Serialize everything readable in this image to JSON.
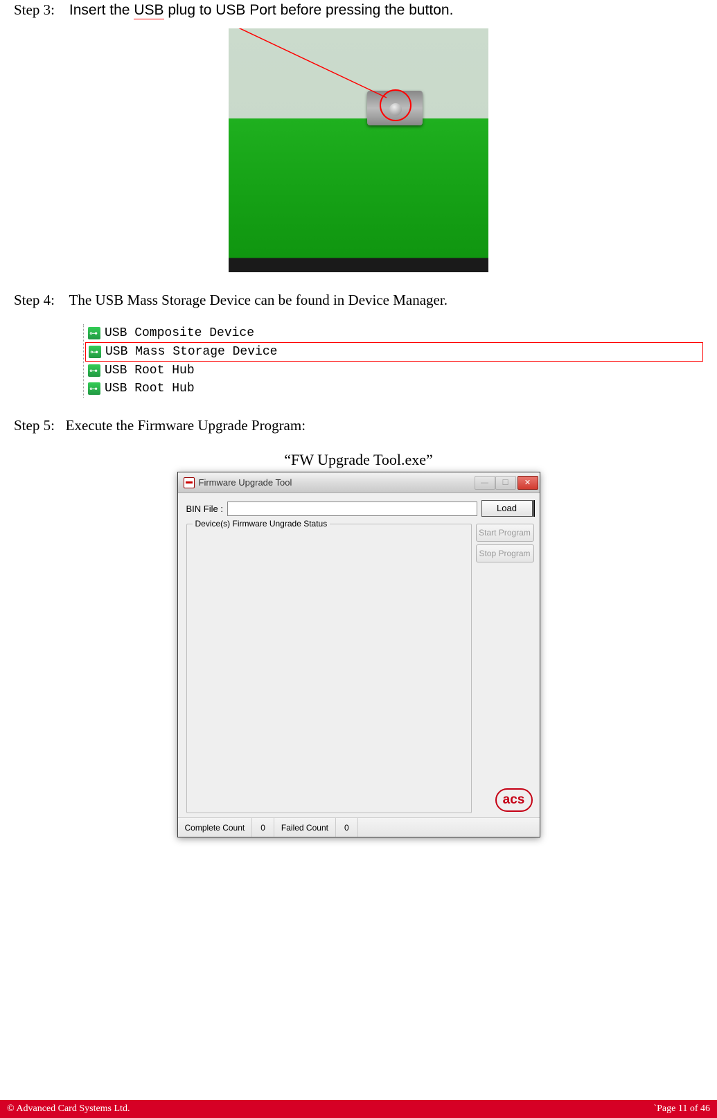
{
  "step3": {
    "label": "Step 3:",
    "sentence_prefix": "Insert the ",
    "usb_word": "USB",
    "sentence_suffix": " plug to USB Port before pressing the button."
  },
  "step4": {
    "label": "Step 4:",
    "text": "The USB Mass Storage Device can be found in Device Manager."
  },
  "device_manager": {
    "items": [
      {
        "name": "USB Composite Device",
        "highlighted": false
      },
      {
        "name": "USB Mass Storage Device",
        "highlighted": true
      },
      {
        "name": "USB Root Hub",
        "highlighted": false
      },
      {
        "name": "USB Root Hub",
        "highlighted": false
      }
    ]
  },
  "step5": {
    "label": "Step 5:",
    "text": "Execute the Firmware Upgrade Program:"
  },
  "exe_caption": "“FW Upgrade Tool.exe”",
  "fw_window": {
    "title": "Firmware Upgrade Tool",
    "bin_label": "BIN File :",
    "bin_value": "",
    "load_button": "Load",
    "group_title": "Device(s) Firmware Ungrade Status",
    "start_button": "Start Program",
    "stop_button": "Stop Program",
    "logo_text": "acs",
    "status": {
      "complete_label": "Complete Count",
      "complete_value": "0",
      "failed_label": "Failed Count",
      "failed_value": "0"
    }
  },
  "footer": {
    "left": "© Advanced Card Systems Ltd.",
    "right": "`Page 11 of 46"
  }
}
